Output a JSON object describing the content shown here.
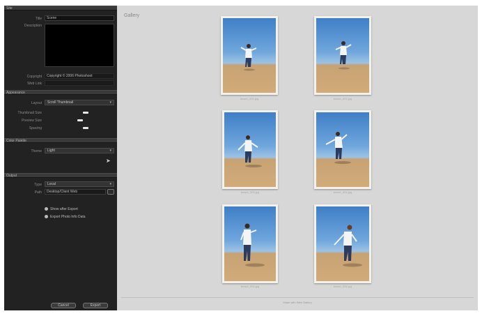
{
  "sidebar": {
    "site_info": {
      "header": "Site",
      "title_label": "Title",
      "title_value": "Scene",
      "description_label": "Description",
      "copyright_label": "Copyright",
      "copyright_value": "Copyright © 2006 Photoshoot",
      "contact_label": "Web Link"
    },
    "appearance": {
      "header": "Appearance",
      "layout_label": "Layout",
      "layout_value": "Scroll Thumbnail",
      "sliders": [
        {
          "label": "Thumbnail Size",
          "level": 0.45
        },
        {
          "label": "Preview Size",
          "level": 0.38
        },
        {
          "label": "Spacing",
          "level": 0.46
        }
      ]
    },
    "color_palette": {
      "header": "Color Palette",
      "theme_label": "Theme",
      "theme_value": "Light"
    },
    "output": {
      "header": "Output",
      "type_label": "Type",
      "type_value": "Local",
      "path_label": "Path",
      "path_value": "Desktop/Client Web",
      "checkboxes": [
        "Show after Export",
        "Export Photo Info Data"
      ]
    },
    "buttons": {
      "cancel": "Cancel",
      "export": "Export"
    }
  },
  "main": {
    "title": "Gallery",
    "photos": [
      {
        "caption": "beach_001.jpg"
      },
      {
        "caption": "beach_002.jpg"
      },
      {
        "caption": "beach_003.jpg"
      },
      {
        "caption": "beach_004.jpg"
      },
      {
        "caption": "beach_005.jpg"
      },
      {
        "caption": "beach_006.jpg"
      }
    ],
    "footer": "Made with Web Gallery"
  },
  "colors": {
    "sidebar_bg": "#222222",
    "canvas_bg": "#d7d7d7",
    "sky": "#4f8fd3",
    "sand": "#cfa877"
  },
  "icons": [
    "dropdown-caret-icon",
    "folder-browse-icon",
    "mouse-cursor-icon",
    "radio-check-icon"
  ]
}
